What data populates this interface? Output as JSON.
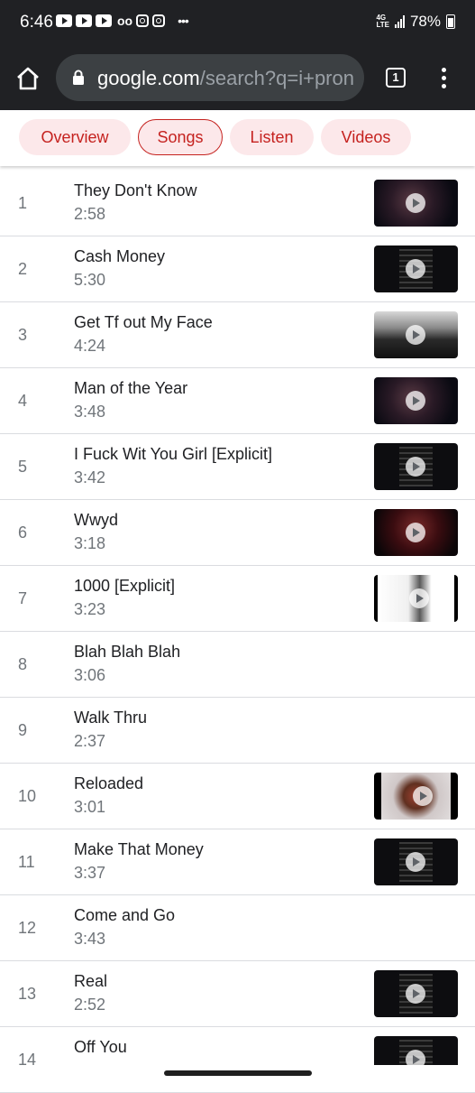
{
  "status_bar": {
    "time": "6:46",
    "network": "4G LTE",
    "battery": "78%"
  },
  "browser": {
    "url_domain": "google.com",
    "url_path": "/search?q=i+pron",
    "tab_count": "1"
  },
  "chips": [
    {
      "label": "Overview",
      "selected": false
    },
    {
      "label": "Songs",
      "selected": true
    },
    {
      "label": "Listen",
      "selected": false
    },
    {
      "label": "Videos",
      "selected": false
    }
  ],
  "colors": {
    "chip_text": "#c5221f",
    "chip_bg": "#fce8ea",
    "top_bar": "#202124"
  },
  "songs": [
    {
      "num": "1",
      "title": "They Don't Know",
      "duration": "2:58",
      "has_video": true
    },
    {
      "num": "2",
      "title": "Cash Money",
      "duration": "5:30",
      "has_video": true
    },
    {
      "num": "3",
      "title": "Get Tf out My Face",
      "duration": "4:24",
      "has_video": true
    },
    {
      "num": "4",
      "title": "Man of the Year",
      "duration": "3:48",
      "has_video": true
    },
    {
      "num": "5",
      "title": "I Fuck Wit You Girl [Explicit]",
      "duration": "3:42",
      "has_video": true
    },
    {
      "num": "6",
      "title": "Wwyd",
      "duration": "3:18",
      "has_video": true
    },
    {
      "num": "7",
      "title": "1000 [Explicit]",
      "duration": "3:23",
      "has_video": true
    },
    {
      "num": "8",
      "title": "Blah Blah Blah",
      "duration": "3:06",
      "has_video": false
    },
    {
      "num": "9",
      "title": "Walk Thru",
      "duration": "2:37",
      "has_video": false
    },
    {
      "num": "10",
      "title": "Reloaded",
      "duration": "3:01",
      "has_video": true
    },
    {
      "num": "11",
      "title": "Make That Money",
      "duration": "3:37",
      "has_video": true
    },
    {
      "num": "12",
      "title": "Come and Go",
      "duration": "3:43",
      "has_video": false
    },
    {
      "num": "13",
      "title": "Real",
      "duration": "2:52",
      "has_video": true
    },
    {
      "num": "14",
      "title": "Off You",
      "duration": "",
      "has_video": true
    }
  ]
}
